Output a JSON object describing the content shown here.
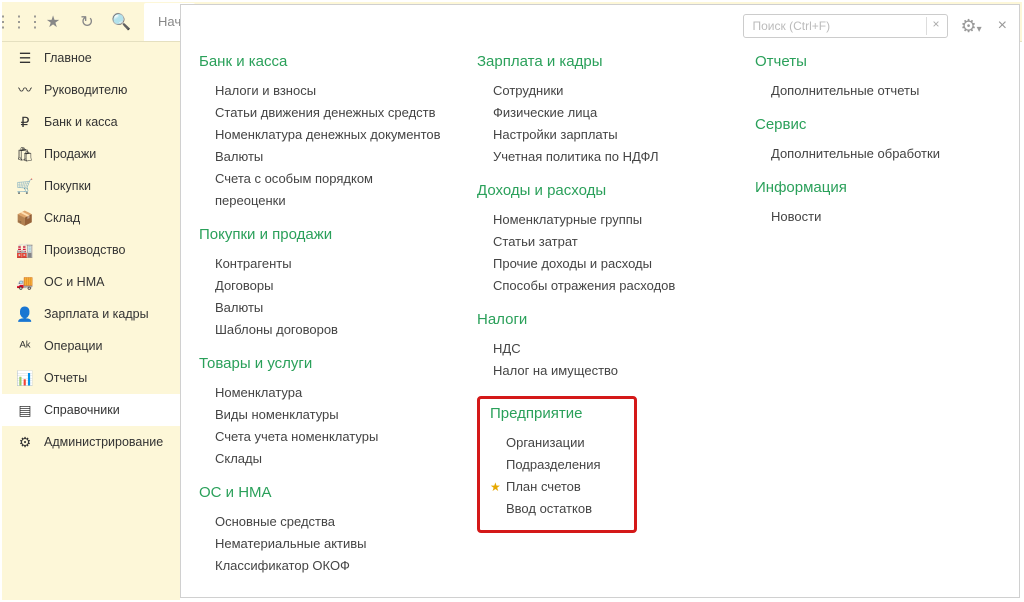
{
  "search_placeholder": "Поиск (Ctrl+F)",
  "tab_label": "Нач",
  "sidebar": {
    "items": [
      {
        "icon": "☰",
        "label": "Главное"
      },
      {
        "icon": "〰",
        "label": "Руководителю"
      },
      {
        "icon": "₽",
        "label": "Банк и касса"
      },
      {
        "icon": "🛍",
        "label": "Продажи"
      },
      {
        "icon": "🛒",
        "label": "Покупки"
      },
      {
        "icon": "📦",
        "label": "Склад"
      },
      {
        "icon": "🏭",
        "label": "Производство"
      },
      {
        "icon": "🚚",
        "label": "ОС и НМА"
      },
      {
        "icon": "👤",
        "label": "Зарплата и кадры"
      },
      {
        "icon": "ᴬᵏ",
        "label": "Операции"
      },
      {
        "icon": "📊",
        "label": "Отчеты"
      },
      {
        "icon": "▤",
        "label": "Справочники"
      },
      {
        "icon": "⚙",
        "label": "Администрирование"
      }
    ],
    "active": 11
  },
  "columns": [
    [
      {
        "title": "Банк и касса",
        "links": [
          "Налоги и взносы",
          "Статьи движения денежных средств",
          "Номенклатура денежных документов",
          "Валюты",
          "Счета с особым порядком переоценки"
        ]
      },
      {
        "title": "Покупки и продажи",
        "links": [
          "Контрагенты",
          "Договоры",
          "Валюты",
          "Шаблоны договоров"
        ]
      },
      {
        "title": "Товары и услуги",
        "links": [
          "Номенклатура",
          "Виды номенклатуры",
          "Счета учета номенклатуры",
          "Склады"
        ]
      },
      {
        "title": "ОС и НМА",
        "links": [
          "Основные средства",
          "Нематериальные активы",
          "Классификатор ОКОФ"
        ]
      }
    ],
    [
      {
        "title": "Зарплата и кадры",
        "links": [
          "Сотрудники",
          "Физические лица",
          "Настройки зарплаты",
          "Учетная политика по НДФЛ"
        ]
      },
      {
        "title": "Доходы и расходы",
        "links": [
          "Номенклатурные группы",
          "Статьи затрат",
          "Прочие доходы и расходы",
          "Способы отражения расходов"
        ]
      },
      {
        "title": "Налоги",
        "links": [
          "НДС",
          "Налог на имущество"
        ]
      },
      {
        "title": "Предприятие",
        "highlight": true,
        "links": [
          "Организации",
          "Подразделения",
          "План счетов",
          "Ввод остатков"
        ],
        "star_index": 2
      }
    ],
    [
      {
        "title": "Отчеты",
        "links": [
          "Дополнительные отчеты"
        ]
      },
      {
        "title": "Сервис",
        "links": [
          "Дополнительные обработки"
        ]
      },
      {
        "title": "Информация",
        "links": [
          "Новости"
        ]
      }
    ]
  ]
}
